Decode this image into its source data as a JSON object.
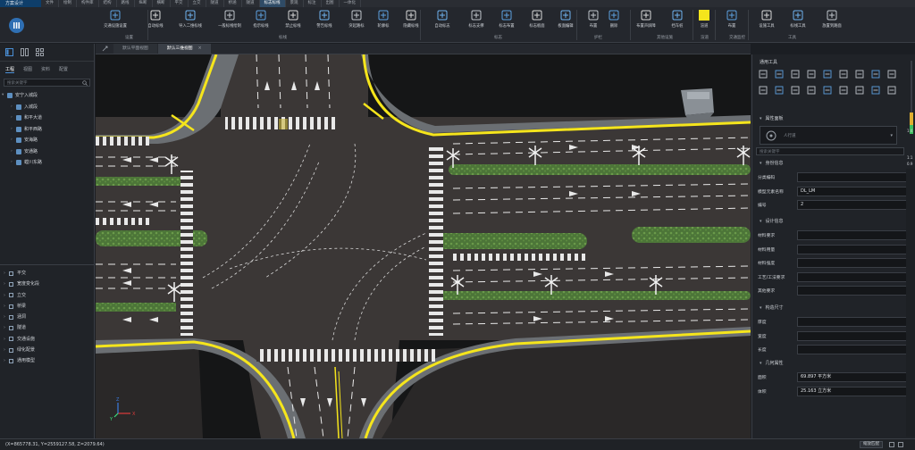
{
  "app": {
    "title": "方案设计"
  },
  "top_tabs": [
    "文件",
    "绘制",
    "构件库",
    "结构",
    "路线",
    "纵断",
    "横断",
    "平交",
    "立交",
    "隧道",
    "桥涵",
    "隧道",
    "标志标线",
    "景观",
    "标注",
    "出图",
    "一体化"
  ],
  "active_top_tab_index": 12,
  "ribbon": {
    "buttons": [
      {
        "label": "交通设施设置",
        "icon": "traffic-facility-icon"
      },
      {
        "label": "自动标线",
        "icon": "auto-marking-icon"
      },
      {
        "label": "导入二维标线",
        "icon": "import-2d-marking-icon"
      },
      {
        "label": "一般标线绘制",
        "icon": "general-marking-icon"
      },
      {
        "label": "指示标线",
        "icon": "indicator-marking-icon"
      },
      {
        "label": "禁止标线",
        "icon": "prohibit-marking-icon"
      },
      {
        "label": "警告标线",
        "icon": "warning-marking-icon"
      },
      {
        "label": "突起路标",
        "icon": "raised-marker-icon"
      },
      {
        "label": "轮廓标",
        "icon": "delineator-icon"
      },
      {
        "label": "隐藏标线",
        "icon": "hide-marking-icon"
      },
      {
        "label": "自动标志",
        "icon": "auto-sign-icon"
      },
      {
        "label": "标志支撑",
        "icon": "sign-support-icon"
      },
      {
        "label": "标志布置",
        "icon": "sign-layout-icon"
      },
      {
        "label": "标志板面",
        "icon": "sign-panel-icon"
      },
      {
        "label": "板面编辑",
        "icon": "panel-edit-icon"
      },
      {
        "label": "布置",
        "icon": "guardrail-layout-icon"
      },
      {
        "label": "删除",
        "icon": "guardrail-delete-icon"
      },
      {
        "label": "布置声屏障",
        "icon": "sound-barrier-icon"
      },
      {
        "label": "挡车桩",
        "icon": "bollard-icon"
      },
      {
        "label": "渲道",
        "icon": "channel-icon"
      },
      {
        "label": "布置",
        "icon": "traffic-monitor-layout-icon"
      },
      {
        "label": "设施工具",
        "icon": "facility-tool-icon"
      },
      {
        "label": "标线工具",
        "icon": "marking-tool-icon"
      },
      {
        "label": "放置到路面",
        "icon": "place-on-road-icon"
      }
    ],
    "groups": [
      "设置",
      "标线",
      "标志",
      "护栏",
      "其他设施",
      "渲道",
      "交通监控",
      "工具"
    ]
  },
  "left_panel": {
    "tabs": [
      "工程",
      "视图",
      "资料",
      "配置"
    ],
    "active_tab_index": 0,
    "search_placeholder": "搜索关键字",
    "tree_root": "安宁入城段",
    "tree_items": [
      "入城段",
      "和平大道",
      "和平西路",
      "安海路",
      "安通路",
      "螳川东路"
    ],
    "lower_items": [
      "平交",
      "宽度变化段",
      "立交",
      "桥梁",
      "涵洞",
      "隧道",
      "交通设施",
      "绿化配景",
      "通用模型"
    ]
  },
  "viewport": {
    "tabs": [
      "默认平面视图",
      "默认三维视图"
    ],
    "active_tab_index": 1,
    "axes": {
      "x": "X",
      "y": "Y",
      "z": "Z"
    }
  },
  "right_panel": {
    "tools_title": "通用工具",
    "tool_icons": [
      "trash-icon",
      "move-icon",
      "copy-icon",
      "rotate-icon",
      "scale-icon",
      "mirror-icon",
      "align-icon",
      "array-icon",
      "snap-icon",
      "measure-icon",
      "break-icon",
      "trim-icon",
      "extend-icon",
      "fillet-icon",
      "chamfer-icon",
      "offset-icon",
      "join-icon",
      "explode-icon"
    ],
    "properties_title": "属性面板",
    "object_type": "人行道",
    "search_placeholder": "搜索关键字",
    "sections": {
      "identity": {
        "title": "身份信息",
        "fields": [
          {
            "label": "分类编码",
            "value": ""
          },
          {
            "label": "模型元素名称",
            "value": "DL_LM"
          },
          {
            "label": "编号",
            "value": "2"
          }
        ]
      },
      "design": {
        "title": "设计信息",
        "fields": [
          {
            "label": "材料要求",
            "value": ""
          },
          {
            "label": "材料用量",
            "value": ""
          },
          {
            "label": "材料强度",
            "value": ""
          },
          {
            "label": "工艺/工法要求",
            "value": ""
          },
          {
            "label": "其他要求",
            "value": ""
          }
        ]
      },
      "size": {
        "title": "构造尺寸",
        "fields": [
          {
            "label": "厚度",
            "value": ""
          },
          {
            "label": "宽度",
            "value": ""
          },
          {
            "label": "长度",
            "value": ""
          }
        ]
      },
      "geometry": {
        "title": "几何属性",
        "fields": [
          {
            "label": "面积",
            "value": "69.897 平方米"
          },
          {
            "label": "体积",
            "value": "25.163 立方米"
          }
        ]
      }
    },
    "zoom_labels": [
      "1:4",
      "1:1",
      "0.9"
    ]
  },
  "statusbar": {
    "coordinates": "(X=865778.31, Y=2559127.58, Z=2079.64)",
    "zoom_fit_label": "缩放匹配"
  },
  "colors": {
    "accent": "#2f6fb3",
    "road_edge": "#f5e51c",
    "asphalt": "#3b3736",
    "median": "#4f7a3a",
    "sidewalk": "#6b6f73"
  }
}
